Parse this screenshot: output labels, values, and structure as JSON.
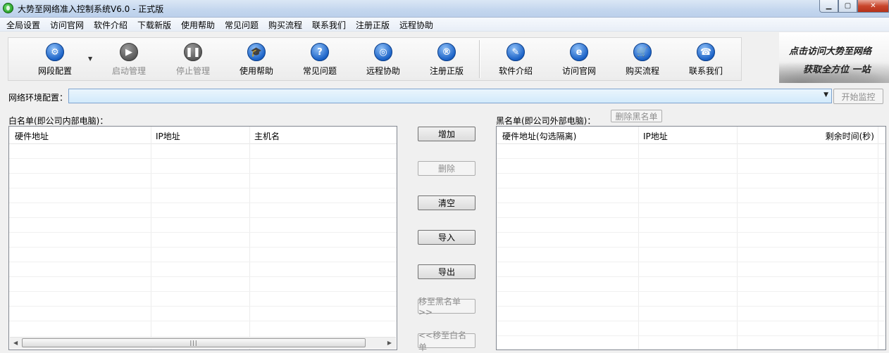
{
  "window": {
    "title": "大势至网络准入控制系统V6.0 - 正式版",
    "controls": [
      "minimize",
      "maximize",
      "close"
    ]
  },
  "menu": {
    "items": [
      "全局设置",
      "访问官网",
      "软件介绍",
      "下载新版",
      "使用帮助",
      "常见问题",
      "购买流程",
      "联系我们",
      "注册正版",
      "远程协助"
    ]
  },
  "toolbar": {
    "buttons": [
      {
        "label": "网段配置",
        "icon": "gear-icon",
        "enabled": true
      },
      {
        "label": "启动管理",
        "icon": "play-icon",
        "enabled": false
      },
      {
        "label": "停止管理",
        "icon": "pause-icon",
        "enabled": false
      },
      {
        "label": "使用帮助",
        "icon": "graduation-cap-icon",
        "enabled": true
      },
      {
        "label": "常见问题",
        "icon": "question-icon",
        "enabled": true
      },
      {
        "label": "远程协助",
        "icon": "globe-icon",
        "enabled": true
      },
      {
        "label": "注册正版",
        "icon": "registered-icon",
        "enabled": true
      },
      {
        "label": "软件介绍",
        "icon": "document-edit-icon",
        "enabled": true
      },
      {
        "label": "访问官网",
        "icon": "browser-icon",
        "enabled": true
      },
      {
        "label": "购买流程",
        "icon": "cart-icon",
        "enabled": true
      },
      {
        "label": "联系我们",
        "icon": "phone-icon",
        "enabled": true
      }
    ]
  },
  "banner": {
    "line1": "点击访问大势至网络",
    "line2": "获取全方位 一站"
  },
  "network": {
    "label": "网络环境配置：",
    "value": "",
    "start_label": "开始监控"
  },
  "whitelist": {
    "label": "白名单(即公司内部电脑)：",
    "columns": [
      "硬件地址",
      "IP地址",
      "主机名"
    ],
    "rows": []
  },
  "blacklist": {
    "label": "黑名单(即公司外部电脑)：",
    "delete_label": "删除黑名单",
    "columns": [
      "硬件地址(勾选隔离)",
      "IP地址",
      "剩余时间(秒)"
    ],
    "rows": []
  },
  "actions": {
    "add": "增加",
    "delete": "删除",
    "clear": "清空",
    "import": "导入",
    "export": "导出",
    "to_black": "移至黑名单>>",
    "to_white": "<<移至白名单"
  }
}
